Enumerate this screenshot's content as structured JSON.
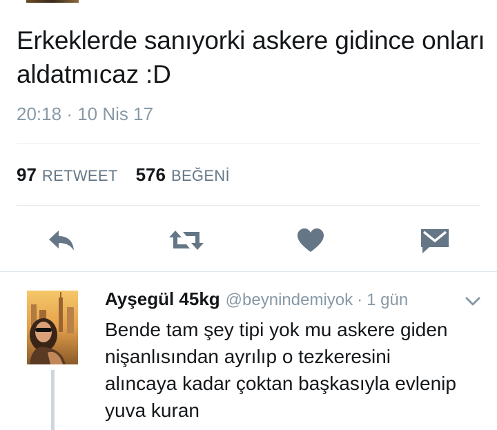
{
  "tweet": {
    "text": "Erkeklerde sanıyorki askere gidince onları aldatmıcaz :D",
    "time": "20:18",
    "date": "10 Nis 17",
    "separator": "·",
    "retweet_count": "97",
    "retweet_label": "RETWEET",
    "like_count": "576",
    "like_label": "BEĞENİ"
  },
  "actions": {
    "icons": [
      "reply-icon",
      "retweet-icon",
      "heart-icon",
      "direct-message-icon"
    ],
    "icon_color": "#657786"
  },
  "reply": {
    "name": "Ayşegül 45kg",
    "handle": "@beynindemiyok",
    "separator": "·",
    "time": "1 gün",
    "text": "Bende tam şey tipi yok mu askere giden\nnişanlısından ayrılıp  o tezkeresini\nalıncaya kadar çoktan başkasıyla evlenip\nyuva kuran"
  },
  "colors": {
    "text": "#14171a",
    "secondary": "#8899a6",
    "divider": "#e1e8ed",
    "thread_line": "#ccd6dd"
  }
}
